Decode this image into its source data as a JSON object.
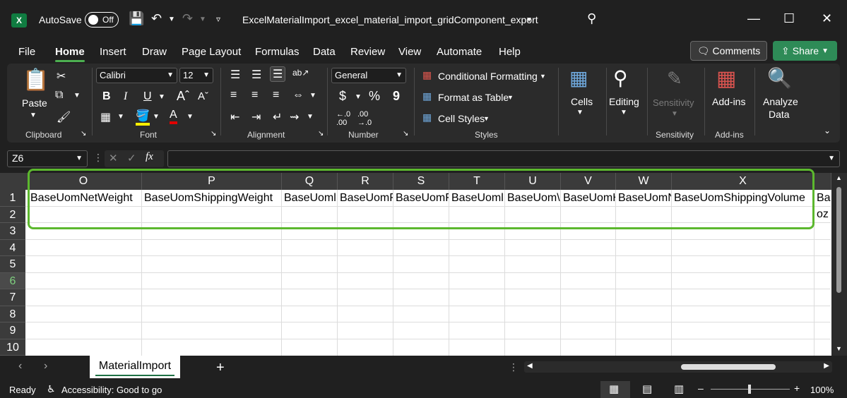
{
  "titlebar": {
    "app_icon": "X",
    "autosave_label": "AutoSave",
    "autosave_state": "Off",
    "doc_title": "ExcelMaterialImport_excel_material_import_gridComponent_export",
    "icons": [
      "save-icon",
      "undo-icon",
      "redo-icon",
      "customize-icon",
      "search-icon",
      "minimize-icon",
      "maximize-icon",
      "close-icon"
    ]
  },
  "menu": {
    "items": [
      "File",
      "Home",
      "Insert",
      "Draw",
      "Page Layout",
      "Formulas",
      "Data",
      "Review",
      "View",
      "Automate",
      "Help"
    ],
    "active": "Home",
    "comments": "Comments",
    "share": "Share"
  },
  "ribbon": {
    "clipboard": {
      "paste": "Paste",
      "label": "Clipboard"
    },
    "font": {
      "name": "Calibri",
      "size": "12",
      "label": "Font",
      "bold": "B",
      "italic": "I",
      "underline": "U"
    },
    "alignment": {
      "label": "Alignment"
    },
    "number": {
      "format": "General",
      "label": "Number",
      "currency": "$",
      "percent": "%",
      "comma": "9"
    },
    "styles": {
      "conditional": "Conditional Formatting",
      "table": "Format as Table",
      "cell_styles": "Cell Styles",
      "label": "Styles"
    },
    "cells": {
      "label": "Cells"
    },
    "editing": {
      "label": "Editing"
    },
    "sensitivity": {
      "button": "Sensitivity",
      "label": "Sensitivity"
    },
    "addins": {
      "button": "Add-ins",
      "label": "Add-ins"
    },
    "analyze": {
      "line1": "Analyze",
      "line2": "Data"
    }
  },
  "formula_bar": {
    "name_box": "Z6",
    "fx": "fx",
    "value": ""
  },
  "grid": {
    "columns": [
      "O",
      "P",
      "Q",
      "R",
      "S",
      "T",
      "U",
      "V",
      "W",
      "X"
    ],
    "rows": [
      "1",
      "2",
      "3",
      "4",
      "5",
      "6",
      "7",
      "8",
      "9",
      "10"
    ],
    "selected_row": "6",
    "row1": [
      "BaseUomNetWeight",
      "BaseUomShippingWeight",
      "BaseUoml",
      "BaseUomF",
      "BaseUomF",
      "BaseUoml",
      "BaseUom\\",
      "BaseUomH",
      "BaseUomN",
      "BaseUomShippingVolume",
      "Ba"
    ],
    "row2_overflow": "oz"
  },
  "sheets": {
    "active": "MaterialImport",
    "add": "+"
  },
  "status": {
    "ready": "Ready",
    "accessibility": "Accessibility: Good to go",
    "zoom": "100%"
  },
  "colors": {
    "accent_green": "#5cb82e",
    "share_green": "#2e8b57",
    "excel_green": "#107c41"
  }
}
